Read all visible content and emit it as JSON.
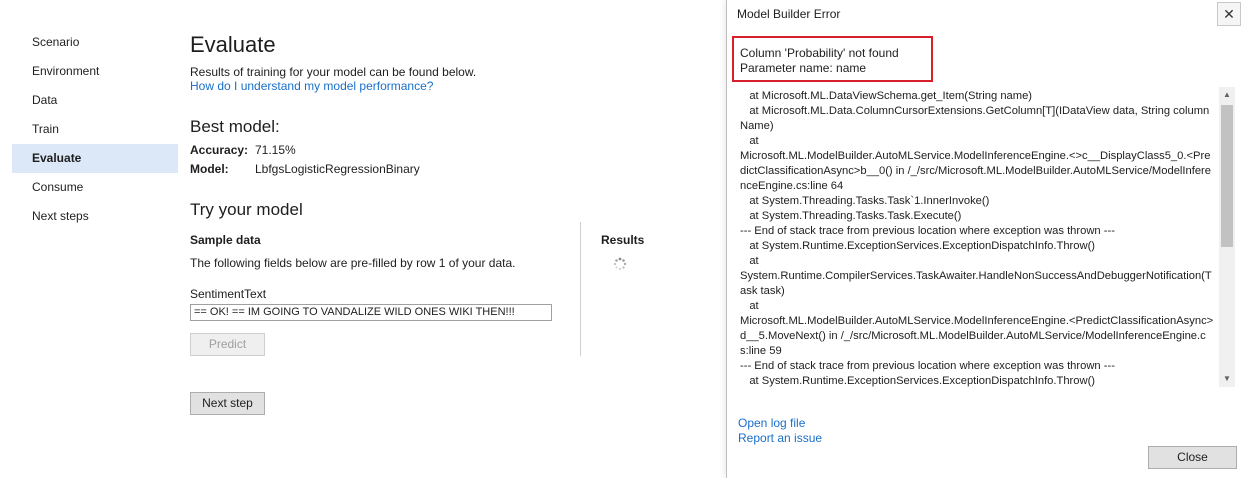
{
  "nav": {
    "items": [
      {
        "label": "Scenario"
      },
      {
        "label": "Environment"
      },
      {
        "label": "Data"
      },
      {
        "label": "Train"
      },
      {
        "label": "Evaluate"
      },
      {
        "label": "Consume"
      },
      {
        "label": "Next steps"
      }
    ],
    "active": "Evaluate"
  },
  "main": {
    "title": "Evaluate",
    "description": "Results of training for your model can be found below.",
    "help_link": "How do I understand my model performance?",
    "best_model": {
      "heading": "Best model:",
      "accuracy_label": "Accuracy:",
      "accuracy_value": "71.15%",
      "model_label": "Model:",
      "model_value": "LbfgsLogisticRegressionBinary"
    },
    "try_model": {
      "heading": "Try your model",
      "sample_heading": "Sample data",
      "sample_desc": "The following fields below are pre-filled by row 1 of your data.",
      "field_label": "SentimentText",
      "field_value": "== OK! ==  IM GOING TO VANDALIZE WILD ONES WIKI THEN!!!",
      "predict_label": "Predict",
      "results_heading": "Results"
    },
    "next_step_label": "Next step"
  },
  "dialog": {
    "title": "Model Builder Error",
    "close_x": "✕",
    "error_line1": "Column 'Probability' not found",
    "error_line2": "Parameter name: name",
    "trace_lines": [
      "   at Microsoft.ML.DataViewSchema.get_Item(String name)",
      "   at Microsoft.ML.Data.ColumnCursorExtensions.GetColumn[T](IDataView data, String columnName)",
      "   at",
      "Microsoft.ML.ModelBuilder.AutoMLService.ModelInferenceEngine.<>c__DisplayClass5_0.<PredictClassificationAsync>b__0() in /_/src/Microsoft.ML.ModelBuilder.AutoMLService/ModelInferenceEngine.cs:line 64",
      "   at System.Threading.Tasks.Task`1.InnerInvoke()",
      "   at System.Threading.Tasks.Task.Execute()",
      "--- End of stack trace from previous location where exception was thrown ---",
      "   at System.Runtime.ExceptionServices.ExceptionDispatchInfo.Throw()",
      "   at",
      "System.Runtime.CompilerServices.TaskAwaiter.HandleNonSuccessAndDebuggerNotification(Task task)",
      "   at",
      "Microsoft.ML.ModelBuilder.AutoMLService.ModelInferenceEngine.<PredictClassificationAsync>d__5.MoveNext() in /_/src/Microsoft.ML.ModelBuilder.AutoMLService/ModelInferenceEngine.cs:line 59",
      "--- End of stack trace from previous location where exception was thrown ---",
      "   at System.Runtime.ExceptionServices.ExceptionDispatchInfo.Throw()"
    ],
    "open_log_label": "Open log file",
    "report_issue_label": "Report an issue",
    "close_label": "Close"
  },
  "colors": {
    "accent_link": "#1a6fc9",
    "active_nav_bg": "#dce8f7",
    "error_highlight": "#d8202a"
  },
  "icons": {
    "spinner": "loading-spinner-icon",
    "scroll_up": "scroll-up-arrow-icon",
    "scroll_down": "scroll-down-arrow-icon",
    "close": "close-icon"
  }
}
